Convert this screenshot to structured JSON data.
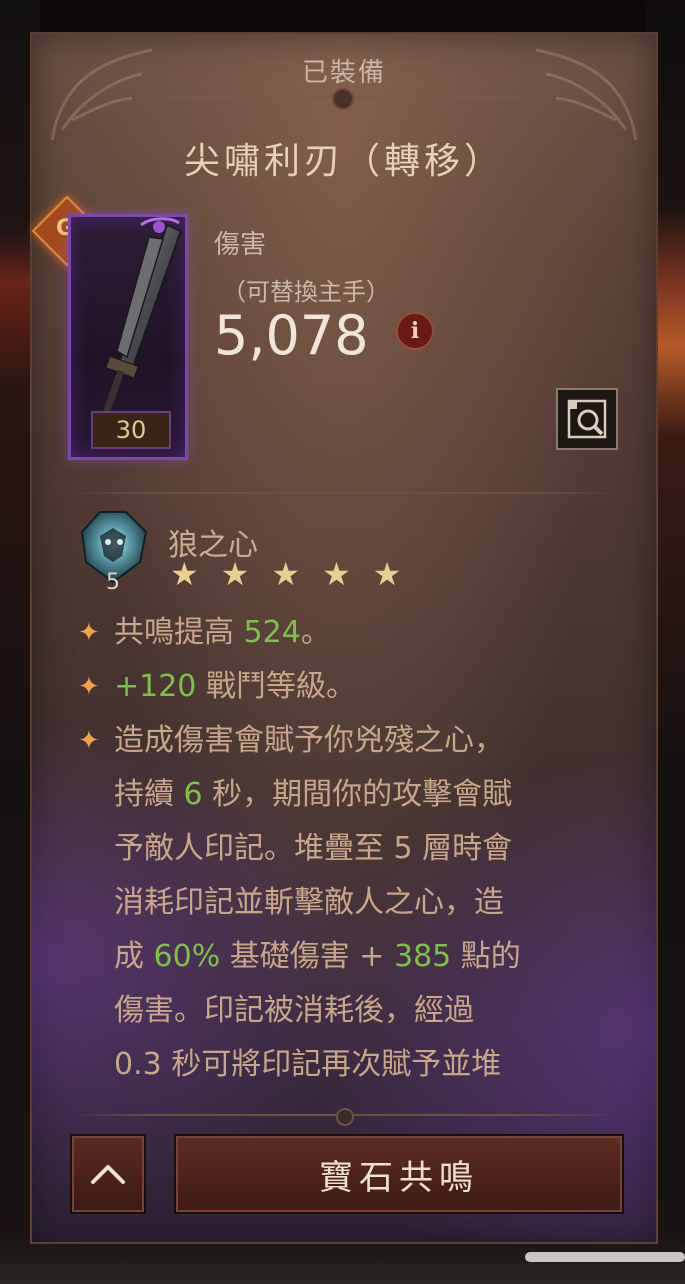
{
  "panel": {
    "header_label": "已裝備",
    "item_title": "尖嘯利刃（轉移）"
  },
  "item": {
    "item_level": "30",
    "rune_glyph": "G",
    "stat_label": "傷害",
    "stat_sub": "（可替換主手）",
    "stat_value": "5,078",
    "info_label": "i"
  },
  "gem": {
    "name": "狼之心",
    "count": "5",
    "stars": 5
  },
  "affixes": [
    {
      "parts": [
        {
          "t": "共鳴提高 "
        },
        {
          "n": "524"
        },
        {
          "t": "。"
        }
      ]
    },
    {
      "parts": [
        {
          "n": "+120"
        },
        {
          "t": " 戰鬥等級。"
        }
      ]
    },
    {
      "parts": [
        {
          "t": "造成傷害會賦予你兇殘之心，"
        },
        {
          "br": true
        },
        {
          "t": "持續 "
        },
        {
          "n": "6"
        },
        {
          "t": " 秒，期間你的攻擊會賦"
        },
        {
          "br": true
        },
        {
          "t": "予敵人印記。堆疊至 5 層時會"
        },
        {
          "br": true
        },
        {
          "t": "消耗印記並斬擊敵人之心，造"
        },
        {
          "br": true
        },
        {
          "t": "成 "
        },
        {
          "n": "60%"
        },
        {
          "t": " 基礎傷害 + "
        },
        {
          "n": "385"
        },
        {
          "t": " 點的"
        },
        {
          "br": true
        },
        {
          "t": "傷害。印記被消耗後，經過"
        },
        {
          "br": true
        },
        {
          "t": "0.3 秒可將印記再次賦予並堆"
        }
      ]
    }
  ],
  "buttons": {
    "collapse_icon": "chevron-up-icon",
    "action_label": "寶石共鳴"
  },
  "colors": {
    "highlight_number": "#7fbf4c",
    "body_text": "#c7a68a",
    "bullet": "#f0a24a",
    "frame_purple": "#7b4aa6"
  }
}
